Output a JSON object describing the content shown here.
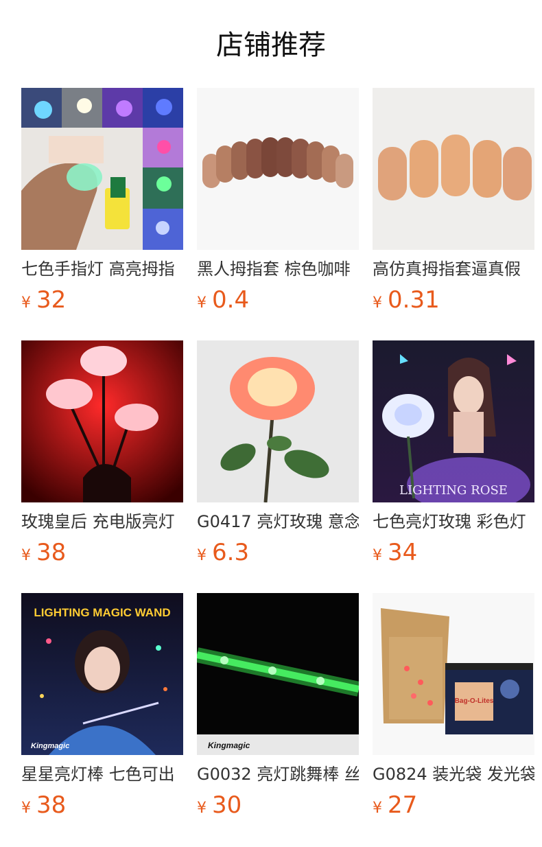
{
  "title": "店铺推荐",
  "currency": "¥",
  "colors": {
    "price": "#e85a1c",
    "text": "#333333"
  },
  "products": [
    {
      "name": "七色手指灯 高亮拇指",
      "price": "32",
      "image": "finger-light-photo"
    },
    {
      "name": "黑人拇指套 棕色咖啡",
      "price": "0.4",
      "image": "brown-thumb-tips-photo"
    },
    {
      "name": "高仿真拇指套逼真假",
      "price": "0.31",
      "image": "realistic-thumb-tips-photo"
    },
    {
      "name": "玫瑰皇后 充电版亮灯",
      "price": "38",
      "image": "rose-queen-photo"
    },
    {
      "name": "G0417 亮灯玫瑰 意念",
      "price": "6.3",
      "image": "lighting-rose-photo"
    },
    {
      "name": "七色亮灯玫瑰 彩色灯",
      "price": "34",
      "image": "lighting-rose-poster",
      "image_text": "LIGHTING ROSE"
    },
    {
      "name": "星星亮灯棒 七色可出",
      "price": "38",
      "image": "lighting-magic-wand-poster",
      "image_text": "LIGHTING MAGIC WAND",
      "logo_text": "Kingmagic"
    },
    {
      "name": "G0032 亮灯跳舞棒 丝",
      "price": "30",
      "image": "dancing-light-stick-photo",
      "logo_text": "Kingmagic"
    },
    {
      "name": "G0824 装光袋 发光袋",
      "price": "27",
      "image": "light-bag-photo",
      "logo_text": "Bag-O-Lites"
    }
  ]
}
